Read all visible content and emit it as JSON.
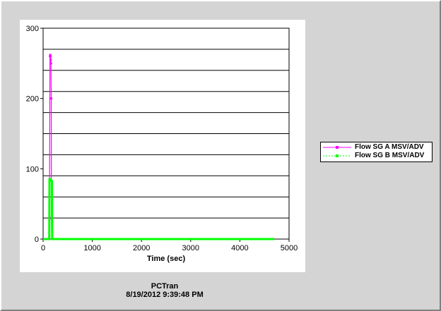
{
  "chart_data": {
    "type": "line",
    "xlabel": "Time (sec)",
    "ylabel": "",
    "xlim": [
      0,
      5000
    ],
    "ylim": [
      0,
      300
    ],
    "x_ticks": [
      "0",
      "1000",
      "2000",
      "3000",
      "4000",
      "5000"
    ],
    "y_ticks": [
      "0",
      "100",
      "200",
      "300"
    ],
    "grid": "horizontal",
    "legend_position": "right",
    "series": [
      {
        "name": "Flow SG A MSV/ADV",
        "color": "#ff00ff",
        "points": [
          [
            0,
            0
          ],
          [
            100,
            0
          ],
          [
            120,
            0
          ],
          [
            130,
            30
          ],
          [
            140,
            260
          ],
          [
            145,
            262
          ],
          [
            150,
            260
          ],
          [
            155,
            255
          ],
          [
            160,
            250
          ],
          [
            165,
            200
          ],
          [
            170,
            30
          ],
          [
            175,
            0
          ],
          [
            180,
            0
          ],
          [
            4700,
            0
          ]
        ]
      },
      {
        "name": "Flow SG B MSV/ADV",
        "color": "#00ff00",
        "points": [
          [
            0,
            0
          ],
          [
            100,
            0
          ],
          [
            125,
            0
          ],
          [
            130,
            85
          ],
          [
            150,
            85
          ],
          [
            170,
            83
          ],
          [
            180,
            82
          ],
          [
            185,
            0
          ],
          [
            190,
            0
          ],
          [
            1000,
            0
          ],
          [
            2000,
            0
          ],
          [
            3000,
            0
          ],
          [
            4000,
            0
          ],
          [
            4700,
            0
          ]
        ]
      }
    ]
  },
  "footer": {
    "app": "PCTran",
    "timestamp": "8/19/2012 9:39:48 PM"
  }
}
